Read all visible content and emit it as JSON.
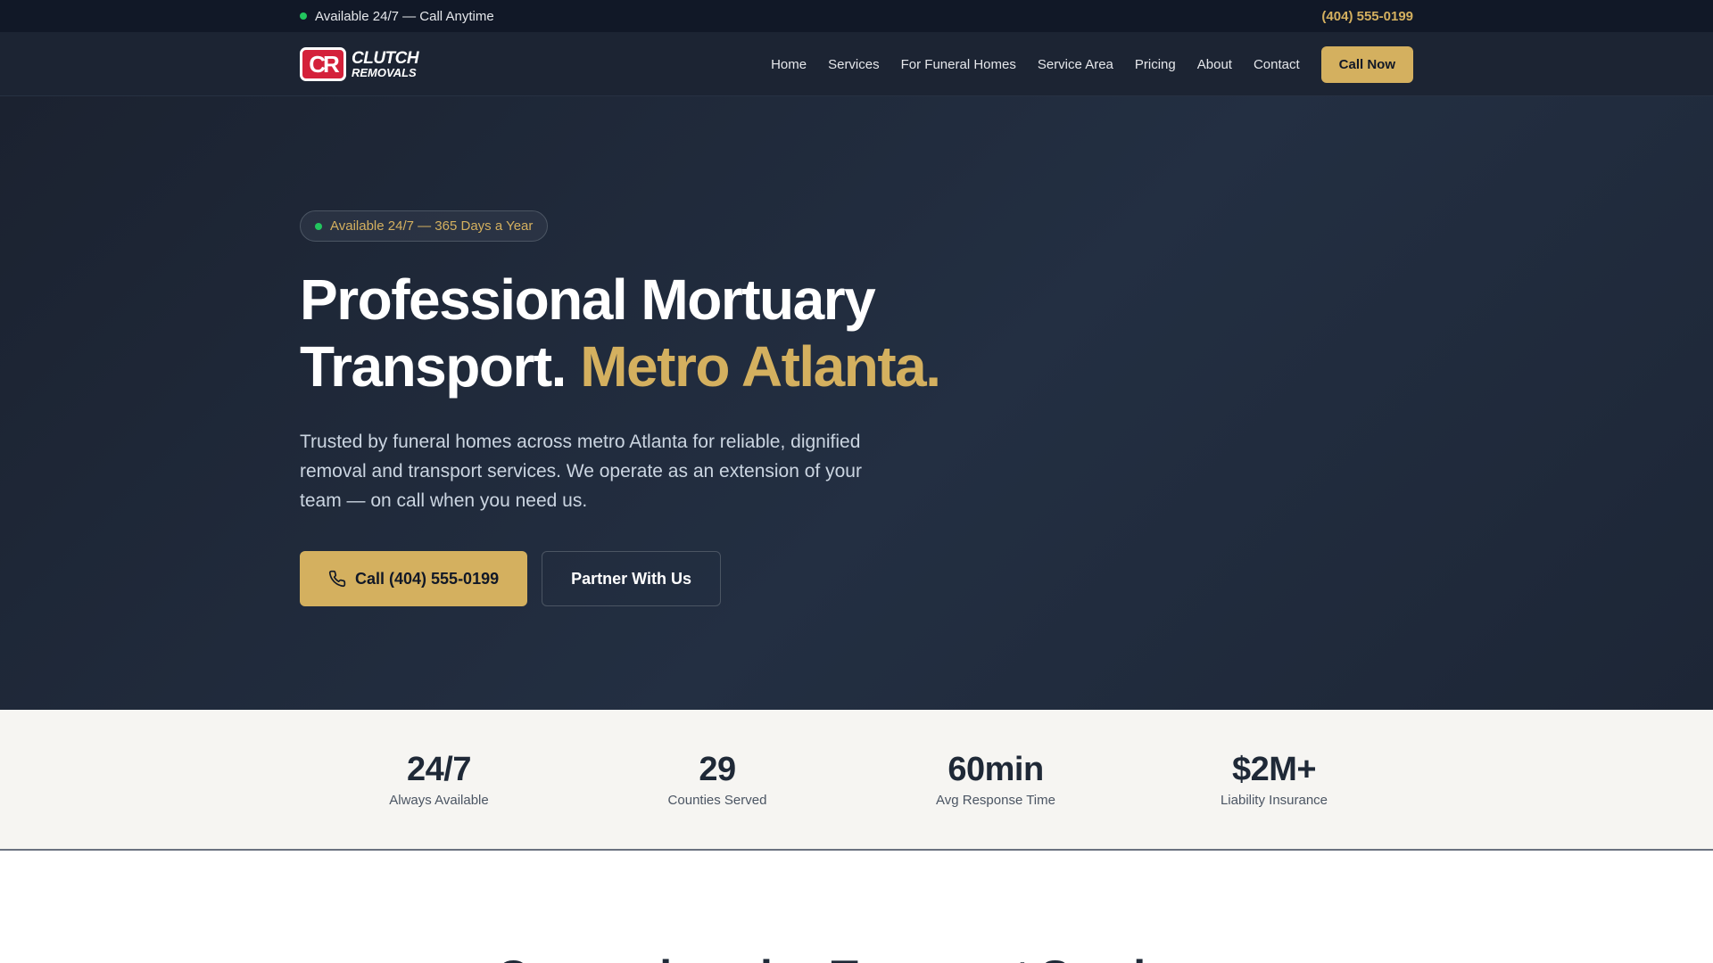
{
  "topbar": {
    "availability": "Available 24/7 — Call Anytime",
    "phone": "(404) 555-0199"
  },
  "brand": {
    "mark": "CR",
    "line1": "CLUTCH",
    "line2": "REMOVALS"
  },
  "nav": {
    "items": [
      "Home",
      "Services",
      "For Funeral Homes",
      "Service Area",
      "Pricing",
      "About",
      "Contact"
    ],
    "cta": "Call Now"
  },
  "hero": {
    "badge": "Available 24/7 — 365 Days a Year",
    "title_line1": "Professional Mortuary",
    "title_line2_plain": "Transport.",
    "title_line2_accent": "Metro Atlanta.",
    "subtitle": "Trusted by funeral homes across metro Atlanta for reliable, dignified removal and transport services. We operate as an extension of your team — on call when you need us.",
    "primary_cta": "Call (404) 555-0199",
    "secondary_cta": "Partner With Us"
  },
  "stats": [
    {
      "value": "24/7",
      "label": "Always Available"
    },
    {
      "value": "29",
      "label": "Counties Served"
    },
    {
      "value": "60min",
      "label": "Avg Response Time"
    },
    {
      "value": "$2M+",
      "label": "Liability Insurance"
    }
  ],
  "next_section": {
    "heading": "Comprehensive Transport Services"
  },
  "colors": {
    "accent": "#d4b05f",
    "status_green": "#22c55e",
    "brand_red": "#d4213a",
    "dark": "#111827"
  }
}
